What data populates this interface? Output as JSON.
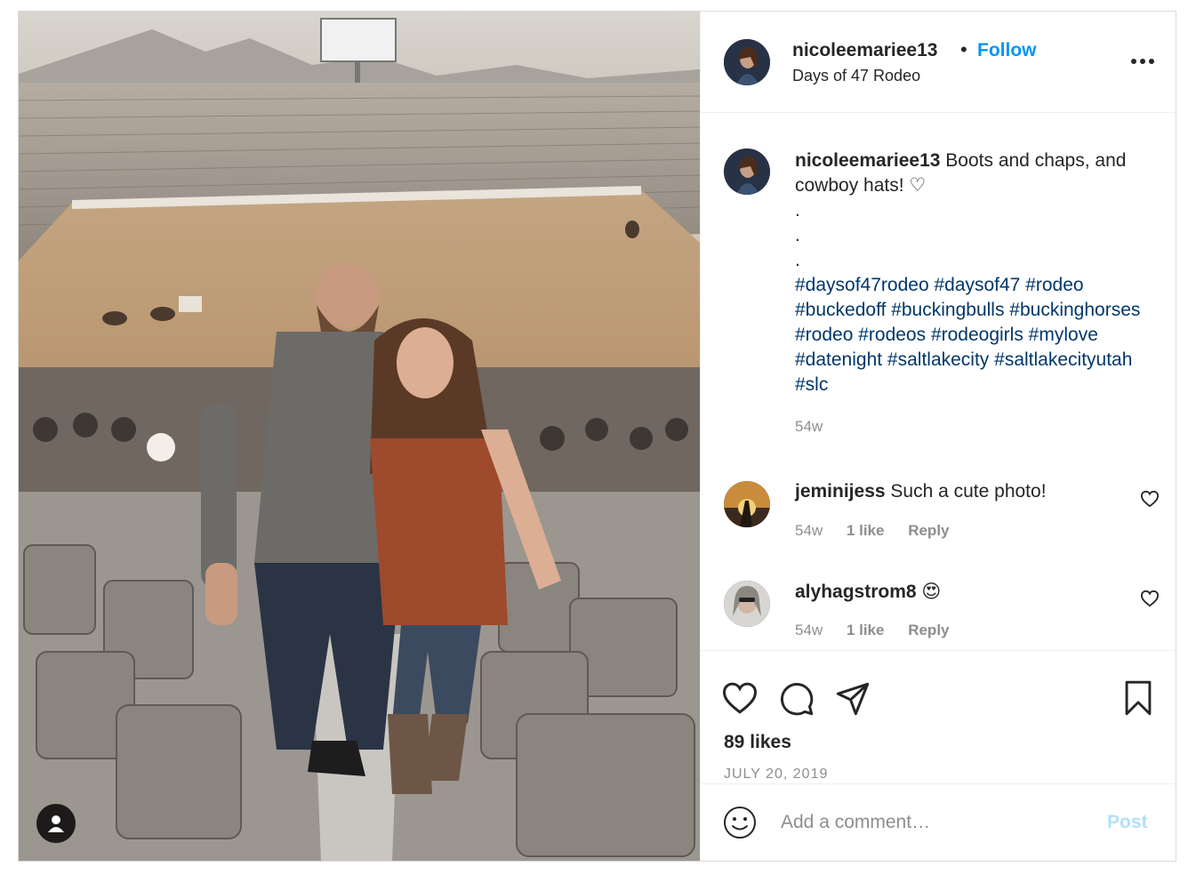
{
  "post": {
    "username": "nicoleemariee13",
    "dot": "•",
    "follow_label": "Follow",
    "location": "Days of 47 Rodeo",
    "more_icon": "more-horizontal-icon"
  },
  "caption": {
    "username": "nicoleemariee13",
    "text": "Boots and chaps, and cowboy hats! ♡",
    "dots": [
      ".",
      ".",
      "."
    ],
    "hashtags": "#daysof47rodeo #daysof47 #rodeo #buckedoff #buckingbulls #buckinghorses #rodeo #rodeos #rodeogirls #mylove #datenight #saltlakecity #saltlakecityutah #slc",
    "time": "54w"
  },
  "comments": [
    {
      "username": "jeminijess",
      "text": "Such a cute photo!",
      "time": "54w",
      "likes": "1 like",
      "reply": "Reply"
    },
    {
      "username": "alyhagstrom8",
      "text": "😍",
      "time": "54w",
      "likes": "1 like",
      "reply": "Reply"
    }
  ],
  "actions": {
    "likes": "89 likes",
    "date": "JULY 20, 2019",
    "icons": [
      "heart-icon",
      "comment-icon",
      "share-icon",
      "bookmark-icon"
    ]
  },
  "add_comment": {
    "placeholder": "Add a comment…",
    "post_label": "Post"
  },
  "colors": {
    "link_blue": "#0095f6",
    "hashtag_blue": "#00376b",
    "post_disabled": "#b2dffc",
    "muted_gray": "#8e8e8e"
  }
}
